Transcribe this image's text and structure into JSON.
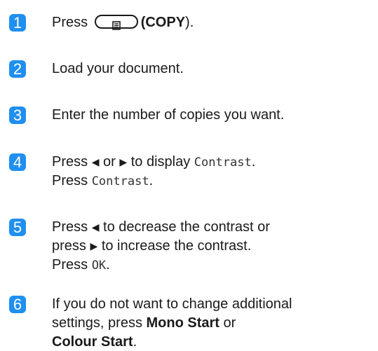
{
  "steps": [
    {
      "number": "1",
      "press": "Press",
      "copy_label": "(COPY",
      "copy_end": ")."
    },
    {
      "number": "2",
      "text": "Load your document."
    },
    {
      "number": "3",
      "text": "Enter the number of copies you want."
    },
    {
      "number": "4",
      "line1_a": "Press",
      "left_arrow": "◀",
      "line1_or": "or",
      "right_arrow": "▶",
      "line1_b": "to display",
      "line1_mono": "Contrast",
      "line1_end": ".",
      "line2_a": "Press",
      "line2_mono": "Contrast",
      "line2_end": "."
    },
    {
      "number": "5",
      "line1_a": "Press",
      "left_arrow": "◀",
      "line1_b": "to decrease the contrast or",
      "line2_a": "press",
      "right_arrow": "▶",
      "line2_b": "to increase the contrast.",
      "line3_a": "Press",
      "line3_mono": "OK",
      "line3_end": "."
    },
    {
      "number": "6",
      "line1": "If you do not want to change additional",
      "line2_a": "settings, press",
      "line2_bold": "Mono Start",
      "line2_b": "or",
      "line3_bold": "Colour Start",
      "line3_end": "."
    }
  ],
  "colors": {
    "badge": "#1f8ff0",
    "text": "#1a1a1a"
  },
  "icons": {
    "copy_key": "copy-document-icon"
  }
}
